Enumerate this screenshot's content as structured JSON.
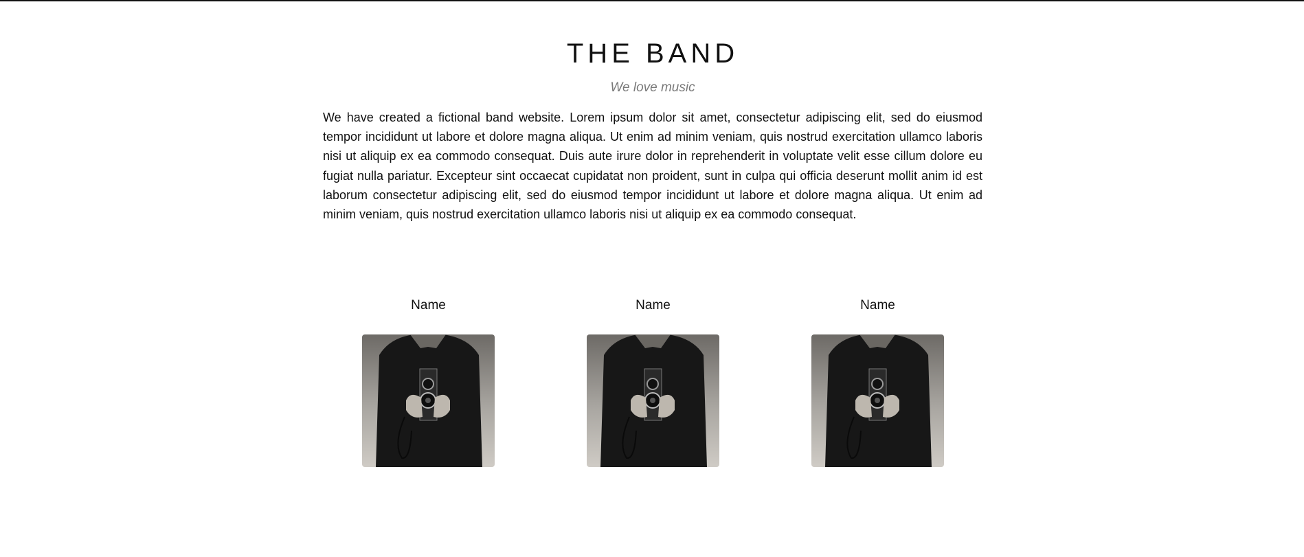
{
  "band": {
    "title": "THE BAND",
    "tagline": "We love music",
    "description": "We have created a fictional band website. Lorem ipsum dolor sit amet, consectetur adipiscing elit, sed do eiusmod tempor incididunt ut labore et dolore magna aliqua. Ut enim ad minim veniam, quis nostrud exercitation ullamco laboris nisi ut aliquip ex ea commodo consequat. Duis aute irure dolor in reprehenderit in voluptate velit esse cillum dolore eu fugiat nulla pariatur. Excepteur sint occaecat cupidatat non proident, sunt in culpa qui officia deserunt mollit anim id est laborum consectetur adipiscing elit, sed do eiusmod tempor incididunt ut labore et dolore magna aliqua. Ut enim ad minim veniam, quis nostrud exercitation ullamco laboris nisi ut aliquip ex ea commodo consequat."
  },
  "members": [
    {
      "name": "Name"
    },
    {
      "name": "Name"
    },
    {
      "name": "Name"
    }
  ]
}
